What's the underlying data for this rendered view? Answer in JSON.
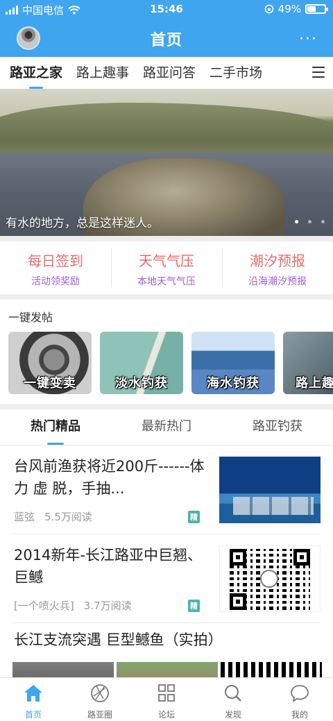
{
  "status_bar": {
    "carrier": "中国电信",
    "time": "15:46",
    "battery_percent": "49%",
    "battery_level": 0.49
  },
  "header": {
    "title": "首页",
    "more_glyph": "···"
  },
  "category_tabs": [
    {
      "label": "路亚之家",
      "active": true
    },
    {
      "label": "路上趣事",
      "active": false
    },
    {
      "label": "路亚问答",
      "active": false
    },
    {
      "label": "二手市场",
      "active": false
    }
  ],
  "banner": {
    "caption": "有水的地方，总是这样迷人。",
    "slide_count": 3,
    "active_slide": 1
  },
  "features": [
    {
      "title": "每日签到",
      "subtitle": "活动领奖励"
    },
    {
      "title": "天气气压",
      "subtitle": "本地天气气压"
    },
    {
      "title": "潮汐预报",
      "subtitle": "沿海潮汐预报"
    }
  ],
  "quick_post": {
    "title": "一键发帖",
    "cards": [
      {
        "label": "一键变卖"
      },
      {
        "label": "淡水钓获"
      },
      {
        "label": "海水钓获"
      },
      {
        "label": "路上趣"
      }
    ]
  },
  "content_tabs": [
    {
      "label": "热门精品",
      "active": true
    },
    {
      "label": "最新热门",
      "active": false
    },
    {
      "label": "路亚钓获",
      "active": false
    }
  ],
  "articles": [
    {
      "title": "台风前渔获将近200斤------体力 虚 脱，手抽...",
      "author": "蓝弦",
      "reads": "5.5万阅读",
      "badge": "精"
    },
    {
      "title": "2014新年-长江路亚中巨翘、巨鳡",
      "author": "[一个喷火兵]",
      "reads": "3.7万阅读",
      "badge": "精"
    },
    {
      "title": "长江支流突遇 巨型鳡鱼（实拍）"
    }
  ],
  "bottom_nav": [
    {
      "label": "首页",
      "icon": "home-icon",
      "active": true
    },
    {
      "label": "路亚圈",
      "icon": "aperture-icon",
      "active": false
    },
    {
      "label": "论坛",
      "icon": "grid-icon",
      "active": false
    },
    {
      "label": "发现",
      "icon": "search-icon",
      "active": false
    },
    {
      "label": "我的",
      "icon": "chat-icon",
      "active": false
    }
  ],
  "colors": {
    "primary": "#3fa5ef",
    "feature_title": "#e86c6c",
    "feature_subtitle": "#a15bd6",
    "badge": "#4cb4a6"
  }
}
